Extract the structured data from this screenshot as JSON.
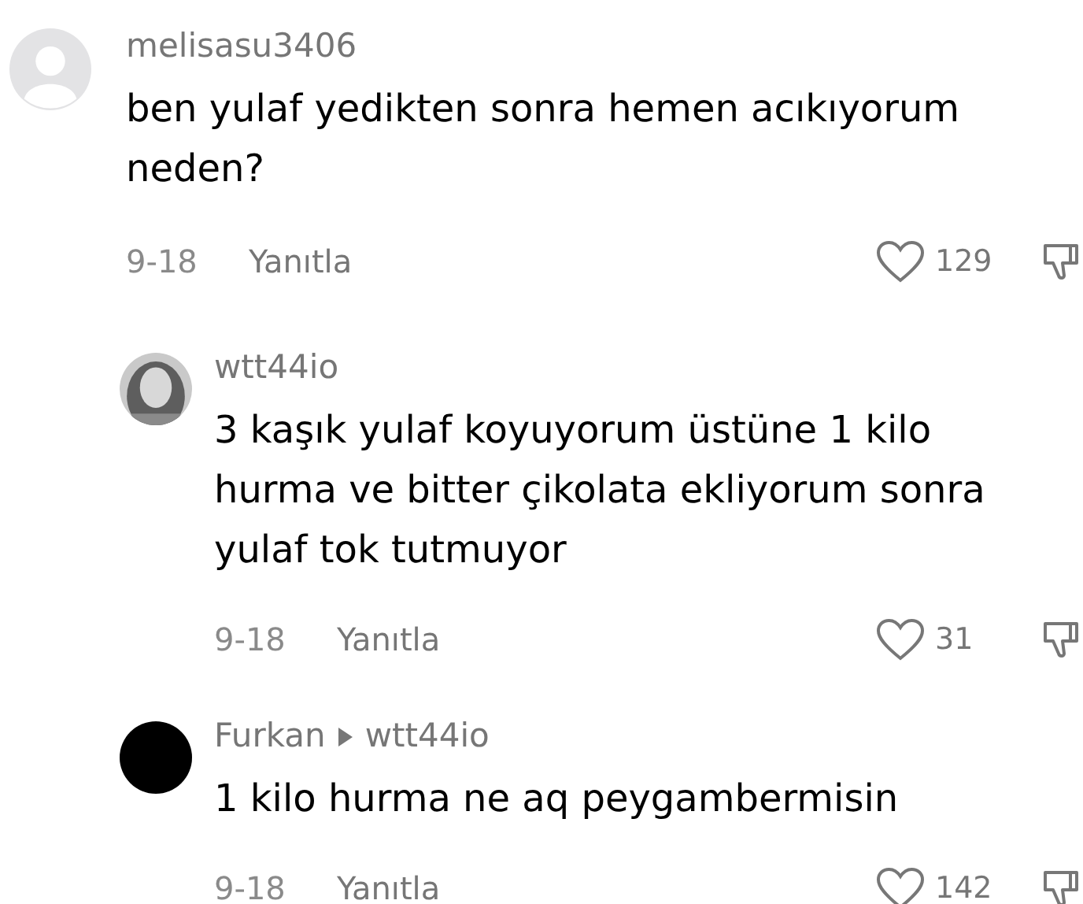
{
  "comments": [
    {
      "avatar": {
        "kind": "default"
      },
      "username": "melisasu3406",
      "text": "ben yulaf yedikten sonra hemen acıkıyorum\nneden?",
      "date": "9-18",
      "reply_label": "Yanıtla",
      "likes": "129",
      "children": [
        {
          "username": "wtt44io",
          "text": "3 kaşık yulaf koyuyorum üstüne 1 kilo\nhurma ve bitter çikolata ekliyorum sonra\nyulaf tok tutmuyor",
          "date": "9-18",
          "reply_label": "Yanıtla",
          "likes": "31"
        },
        {
          "avatar": {
            "kind": "solid"
          },
          "username": "Furkan",
          "reply_to": "wtt44io",
          "text": "1 kilo hurma ne aq peygambermisin",
          "date": "9-18",
          "reply_label": "Yanıtla",
          "likes": "142"
        }
      ]
    }
  ]
}
